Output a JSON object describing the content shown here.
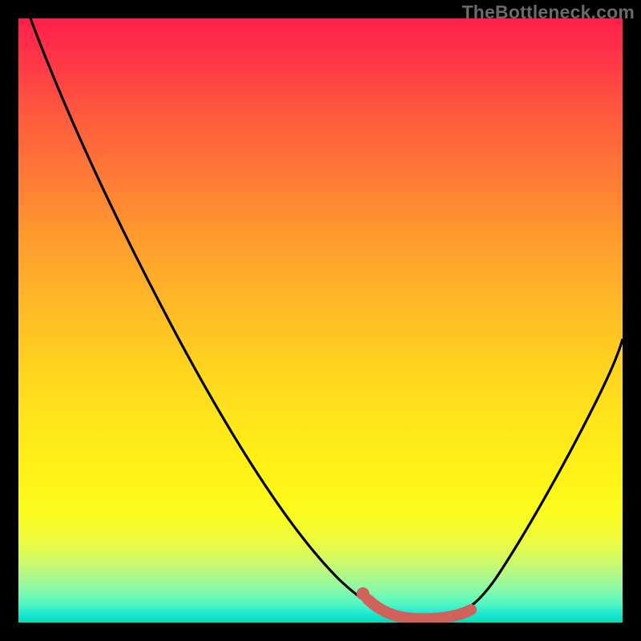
{
  "watermark": "TheBottleneck.com",
  "colors": {
    "background": "#000000",
    "curve_stroke": "#000000",
    "highlight_stroke": "#d0615b",
    "highlight_dot": "#d0615b"
  },
  "chart_data": {
    "type": "line",
    "title": "",
    "xlabel": "",
    "ylabel": "",
    "xlim": [
      0,
      100
    ],
    "ylim": [
      0,
      100
    ],
    "grid": false,
    "legend": false,
    "series": [
      {
        "name": "bottleneck-curve",
        "x": [
          2,
          8,
          14,
          20,
          26,
          32,
          38,
          44,
          50,
          55,
          58,
          61,
          64,
          67,
          70,
          73,
          76,
          80,
          84,
          88,
          92,
          96,
          100
        ],
        "y": [
          100,
          90,
          80,
          70,
          60,
          50,
          40,
          30,
          20,
          11,
          7,
          4,
          2,
          1,
          1,
          1.5,
          3,
          8,
          15,
          23,
          32,
          41,
          50
        ]
      }
    ],
    "annotations": [
      {
        "name": "optimal-range",
        "x_start": 58,
        "x_end": 75,
        "note": "minimum / green zone highlighted segment"
      },
      {
        "name": "optimal-dot",
        "x": 58,
        "y": 7
      }
    ]
  }
}
